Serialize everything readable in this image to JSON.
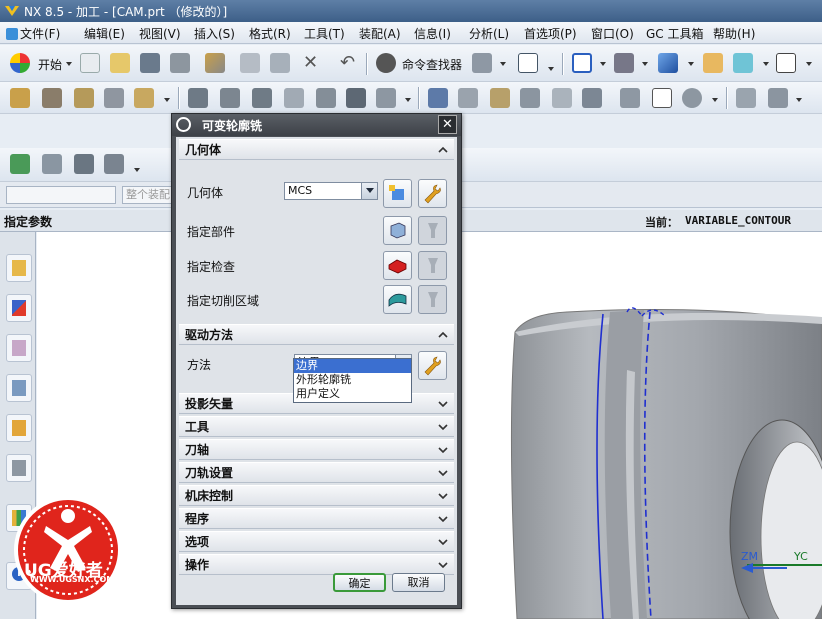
{
  "window": {
    "title": "NX 8.5 - 加工 - [CAM.prt （修改的）]"
  },
  "menubar": {
    "items": [
      "文件(F)",
      "编辑(E)",
      "视图(V)",
      "插入(S)",
      "格式(R)",
      "工具(T)",
      "装配(A)",
      "信息(I)",
      "分析(L)",
      "首选项(P)",
      "窗口(O)",
      "GC 工具箱",
      "帮助(H)"
    ]
  },
  "toolbar": {
    "start_label": "开始",
    "command_finder_label": "命令查找器"
  },
  "selection": {
    "filter_placeholder": "整个装配"
  },
  "navigator": {
    "title": "指定参数",
    "current_label": "当前：",
    "current_value": "VARIABLE_CONTOUR"
  },
  "dialog": {
    "title": "可变轮廓铣",
    "geometry": {
      "header": "几何体",
      "geometry_label": "几何体",
      "geometry_value": "MCS",
      "part_label": "指定部件",
      "check_label": "指定检查",
      "cut_area_label": "指定切削区域"
    },
    "drive": {
      "header": "驱动方法",
      "method_label": "方法",
      "method_value": "边界",
      "options": [
        "边界",
        "外形轮廓铣",
        "用户定义"
      ]
    },
    "collapsed_sections": [
      "投影矢量",
      "工具",
      "刀轴",
      "刀轨设置",
      "机床控制",
      "程序",
      "选项",
      "操作"
    ],
    "ok_label": "确定",
    "cancel_label": "取消"
  },
  "viewport": {
    "zm_label": "ZM",
    "yc_label": "YC"
  },
  "watermark": {
    "brand": "UG爱好者",
    "url": "WWW.UGSNX.COM"
  },
  "colors": {
    "accent": "#3b6fd0",
    "dialog_dark": "#4b4f55",
    "part_gray": "#a9adb2",
    "edge_blue": "#1f2fd0",
    "brand_red": "#e0251c"
  }
}
